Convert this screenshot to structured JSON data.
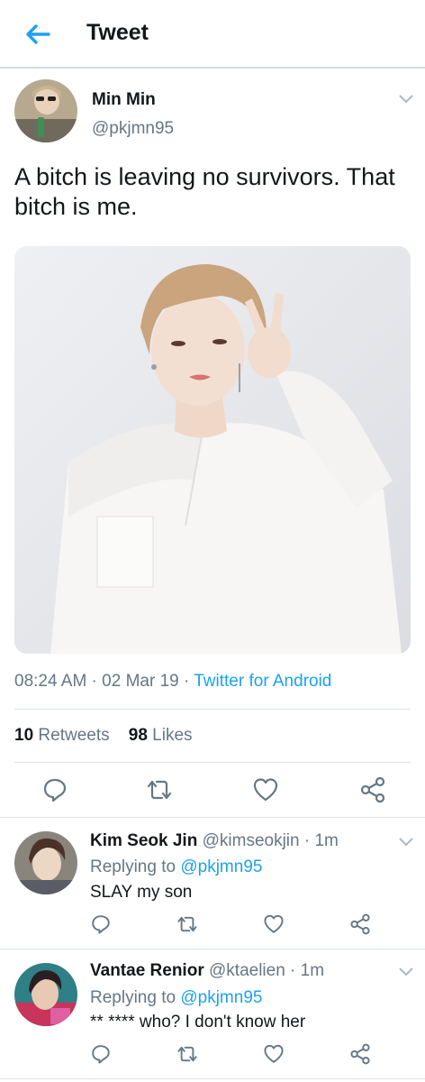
{
  "header": {
    "title": "Tweet",
    "back_icon": "arrow-left-icon",
    "accent": "#1da1f2"
  },
  "tweet": {
    "author_name": "Min Min",
    "author_handle": "@pkjmn95",
    "text": "A bitch is leaving no survivors. That bitch is me.",
    "timestamp": "08:24 AM · 02 Mar 19 · ",
    "source": "Twitter for Android",
    "retweets_count": "10",
    "retweets_label": "Retweets",
    "likes_count": "98",
    "likes_label": "Likes"
  },
  "replies": [
    {
      "name": "Kim Seok Jin",
      "handle_time": "@kimseokjin · 1m",
      "replying_label": "Replying to ",
      "replying_handle": "@pkjmn95",
      "text": "SLAY my son"
    },
    {
      "name": "Vantae Renior",
      "handle_time": "@ktaelien · 1m",
      "replying_label": "Replying to ",
      "replying_handle": "@pkjmn95",
      "text": "** **** who? I don't know her"
    }
  ],
  "icons": [
    "reply-icon",
    "retweet-icon",
    "like-icon",
    "share-icon",
    "chevron-down-icon"
  ]
}
